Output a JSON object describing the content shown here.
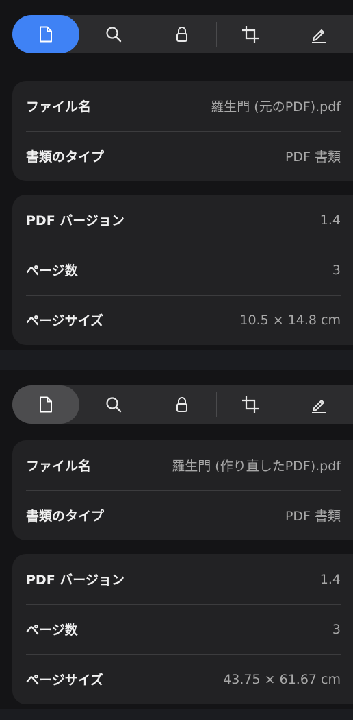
{
  "inspectors": [
    {
      "toolbar": {
        "active_tab": "document",
        "tabs": [
          {
            "id": "document",
            "icon": "document-icon"
          },
          {
            "id": "search",
            "icon": "search-icon"
          },
          {
            "id": "security",
            "icon": "lock-icon"
          },
          {
            "id": "crop",
            "icon": "crop-icon"
          },
          {
            "id": "markup",
            "icon": "pencil-icon"
          }
        ]
      },
      "file_info": [
        {
          "label": "ファイル名",
          "value": "羅生門 (元のPDF).pdf"
        },
        {
          "label": "書類のタイプ",
          "value": "PDF 書類"
        }
      ],
      "pdf_info": [
        {
          "label": "PDF バージョン",
          "value": "1.4"
        },
        {
          "label": "ページ数",
          "value": "3"
        },
        {
          "label": "ページサイズ",
          "value": "10.5 × 14.8 cm"
        }
      ]
    },
    {
      "toolbar": {
        "active_tab": "document",
        "tabs": [
          {
            "id": "document",
            "icon": "document-icon"
          },
          {
            "id": "search",
            "icon": "search-icon"
          },
          {
            "id": "security",
            "icon": "lock-icon"
          },
          {
            "id": "crop",
            "icon": "crop-icon"
          },
          {
            "id": "markup",
            "icon": "pencil-icon"
          }
        ]
      },
      "file_info": [
        {
          "label": "ファイル名",
          "value": "羅生門 (作り直したPDF).pdf"
        },
        {
          "label": "書類のタイプ",
          "value": "PDF 書類"
        }
      ],
      "pdf_info": [
        {
          "label": "PDF バージョン",
          "value": "1.4"
        },
        {
          "label": "ページ数",
          "value": "3"
        },
        {
          "label": "ページサイズ",
          "value": "43.75 × 61.67 cm"
        }
      ]
    }
  ],
  "colors": {
    "accent": "#3f82f5",
    "selected_tab": "#4c4c4e",
    "panel": "#141416",
    "card": "#222224",
    "label": "#f0f0f0",
    "value": "#a8a8a8"
  }
}
